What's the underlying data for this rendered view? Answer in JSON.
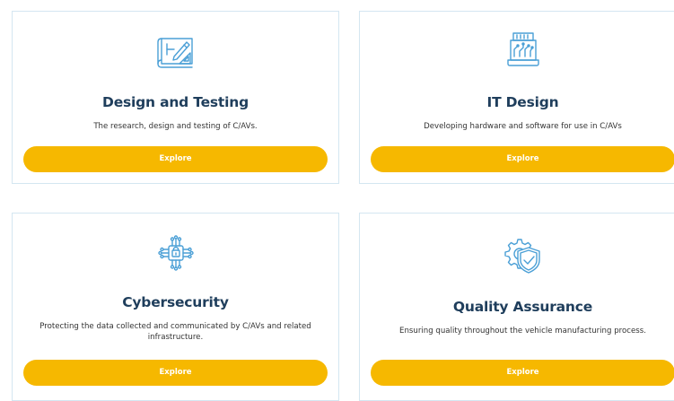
{
  "cards": [
    {
      "icon": "blueprint-pencil-icon",
      "title": "Design and Testing",
      "description": "The research, design and testing of C/AVs.",
      "button": "Explore"
    },
    {
      "icon": "circuit-board-monitor-icon",
      "title": "IT Design",
      "description": "Developing hardware and software for use in C/AVs",
      "button": "Explore"
    },
    {
      "icon": "lock-chip-icon",
      "title": "Cybersecurity",
      "description": "Protecting the data collected and communicated by C/AVs and related infrastructure.",
      "button": "Explore"
    },
    {
      "icon": "gear-shield-check-icon",
      "title": "Quality Assurance",
      "description": "Ensuring quality throughout the vehicle manufacturing process.",
      "button": "Explore"
    }
  ],
  "colors": {
    "accent": "#f6b800",
    "title": "#1f3e5c",
    "icon": "#4a9fd6",
    "border": "#d4e6f1"
  }
}
